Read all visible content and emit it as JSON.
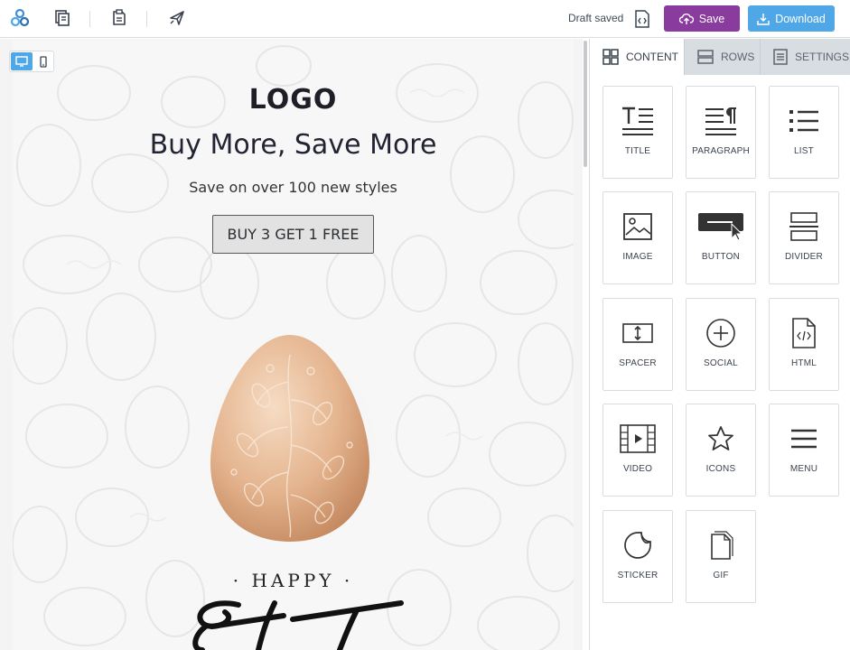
{
  "toolbar": {
    "draft_status": "Draft saved",
    "save_label": "Save",
    "download_label": "Download",
    "icons": [
      "brand-logo-icon",
      "copy-template-icon",
      "template-settings-icon",
      "send-test-icon"
    ]
  },
  "device_toggle": {
    "options": [
      "desktop-icon",
      "mobile-icon"
    ],
    "selected": "desktop"
  },
  "email": {
    "logo_text": "LOGO",
    "headline": "Buy More, Save More",
    "subheadline": "Save on over 100 new styles",
    "cta_label": "BUY 3 GET 1 FREE",
    "happy_text": "· HAPPY ·",
    "script_text": "Easter"
  },
  "panel": {
    "tabs": [
      {
        "label": "CONTENT",
        "icon": "grid-icon",
        "active": true
      },
      {
        "label": "ROWS",
        "icon": "rows-icon",
        "active": false
      },
      {
        "label": "SETTINGS",
        "icon": "settings-doc-icon",
        "active": false
      }
    ],
    "blocks": [
      {
        "label": "TITLE",
        "icon": "title-icon"
      },
      {
        "label": "PARAGRAPH",
        "icon": "paragraph-icon"
      },
      {
        "label": "LIST",
        "icon": "list-icon"
      },
      {
        "label": "IMAGE",
        "icon": "image-icon"
      },
      {
        "label": "BUTTON",
        "icon": "button-icon"
      },
      {
        "label": "DIVIDER",
        "icon": "divider-icon"
      },
      {
        "label": "SPACER",
        "icon": "spacer-icon"
      },
      {
        "label": "SOCIAL",
        "icon": "social-icon"
      },
      {
        "label": "HTML",
        "icon": "html-icon"
      },
      {
        "label": "VIDEO",
        "icon": "video-icon"
      },
      {
        "label": "ICONS",
        "icon": "star-icon"
      },
      {
        "label": "MENU",
        "icon": "menu-icon"
      },
      {
        "label": "STICKER",
        "icon": "sticker-icon"
      },
      {
        "label": "GIF",
        "icon": "gif-icon"
      }
    ]
  },
  "colors": {
    "save": "#8a3b9e",
    "download": "#4fa7e8",
    "accent": "#4fa7e8"
  }
}
